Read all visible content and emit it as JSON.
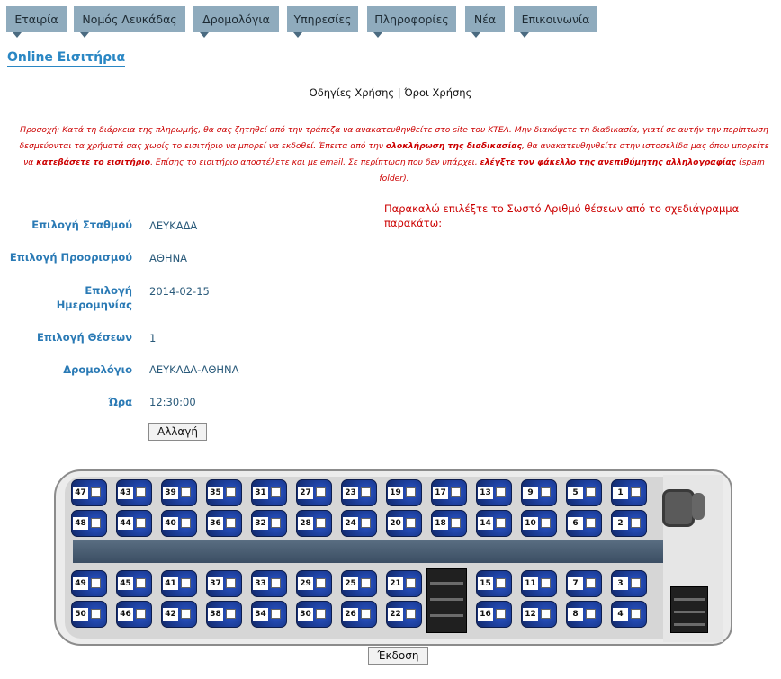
{
  "nav": {
    "items": [
      {
        "label": "Εταιρία"
      },
      {
        "label": "Νομός Λευκάδας"
      },
      {
        "label": "Δρομολόγια"
      },
      {
        "label": "Υπηρεσίες"
      },
      {
        "label": "Πληροφορίες"
      },
      {
        "label": "Νέα"
      },
      {
        "label": "Επικοινωνία"
      }
    ]
  },
  "page": {
    "title": "Online Εισιτήρια",
    "link_instructions": "Οδηγίες Χρήσης",
    "link_separator": "|",
    "link_terms": "Όροι Χρήσης"
  },
  "notice": {
    "part1": "Προσοχή: Κατά τη διάρκεια της πληρωμής, θα σας ζητηθεί από την τράπεζα να ανακατευθηνθείτε στο site του ΚΤΕΛ. Μην διακόψετε τη διαδικασία, γιατί σε αυτήν την περίπτωση δεσμεύονται τα χρήματά σας χωρίς το εισιτήριο να μπορεί να εκδοθεί. Έπειτα από την ",
    "bold1": "ολοκλήρωση της διαδικασίας",
    "part2": ", θα ανακατευθηνθείτε στην ιστοσελίδα μας όπου μπορείτε να ",
    "bold2": "κατεβάσετε το εισιτήριο",
    "part3": ". Επίσης το εισιτήριο αποστέλετε και με email. Σε περίπτωση που δεν υπάρχει, ",
    "bold3": "ελέγξτε τον φάκελλο της ανεπιθύμητης αλληλογραφίας",
    "part4": " (spam folder)."
  },
  "form": {
    "station_label": "Επιλογή Σταθμού",
    "station_value": "ΛΕΥΚΑΔΑ",
    "destination_label": "Επιλογή Προορισμού",
    "destination_value": "ΑΘΗΝΑ",
    "date_label": "Επιλογή Ημερομηνίας",
    "date_value": "2014-02-15",
    "seats_label": "Επιλογή Θέσεων",
    "seats_value": "1",
    "route_label": "Δρομολόγιο",
    "route_value": "ΛΕΥΚΑΔΑ-ΑΘΗΝΑ",
    "time_label": "Ώρα",
    "time_value": "12:30:00",
    "change_button": "Αλλαγή"
  },
  "instructions": "Παρακαλώ επιλέξτε το Σωστό Αριθμό θέσεων από το σχεδιάγραμμα παρακάτω:",
  "seats": {
    "row1": [
      "47",
      "43",
      "39",
      "35",
      "31",
      "27",
      "23",
      "19",
      "17",
      "13",
      "9",
      "5",
      "1"
    ],
    "row2": [
      "48",
      "44",
      "40",
      "36",
      "32",
      "28",
      "24",
      "20",
      "18",
      "14",
      "10",
      "6",
      "2"
    ],
    "row3": [
      "49",
      "45",
      "41",
      "37",
      "33",
      "29",
      "25",
      "21",
      "15",
      "11",
      "7",
      "3"
    ],
    "row4": [
      "50",
      "46",
      "42",
      "38",
      "34",
      "30",
      "26",
      "22",
      "16",
      "12",
      "8",
      "4"
    ]
  },
  "issue_button": "Έκδοση"
}
